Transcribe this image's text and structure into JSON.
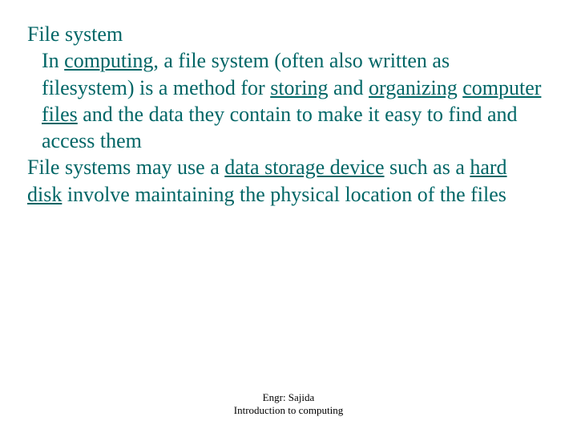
{
  "title": "File system",
  "para1": {
    "t1": "In ",
    "link_computing": "computing",
    "t2": ", a file system (often also written as filesystem) is a method for ",
    "link_storing": "storing",
    "t3": " and ",
    "link_organizing": "organizing",
    "t4": " ",
    "link_computer_files": "computer files",
    "t5": " and the data they contain to make it easy to find and access them"
  },
  "para2": {
    "t1": "File systems may use a ",
    "link_data_storage_device": "data storage device",
    "t2": " such as a ",
    "link_hard_disk": "hard disk",
    "t3": " involve maintaining the physical location of the files"
  },
  "footer": {
    "line1": "Engr: Sajida",
    "line2": "Introduction to computing"
  }
}
